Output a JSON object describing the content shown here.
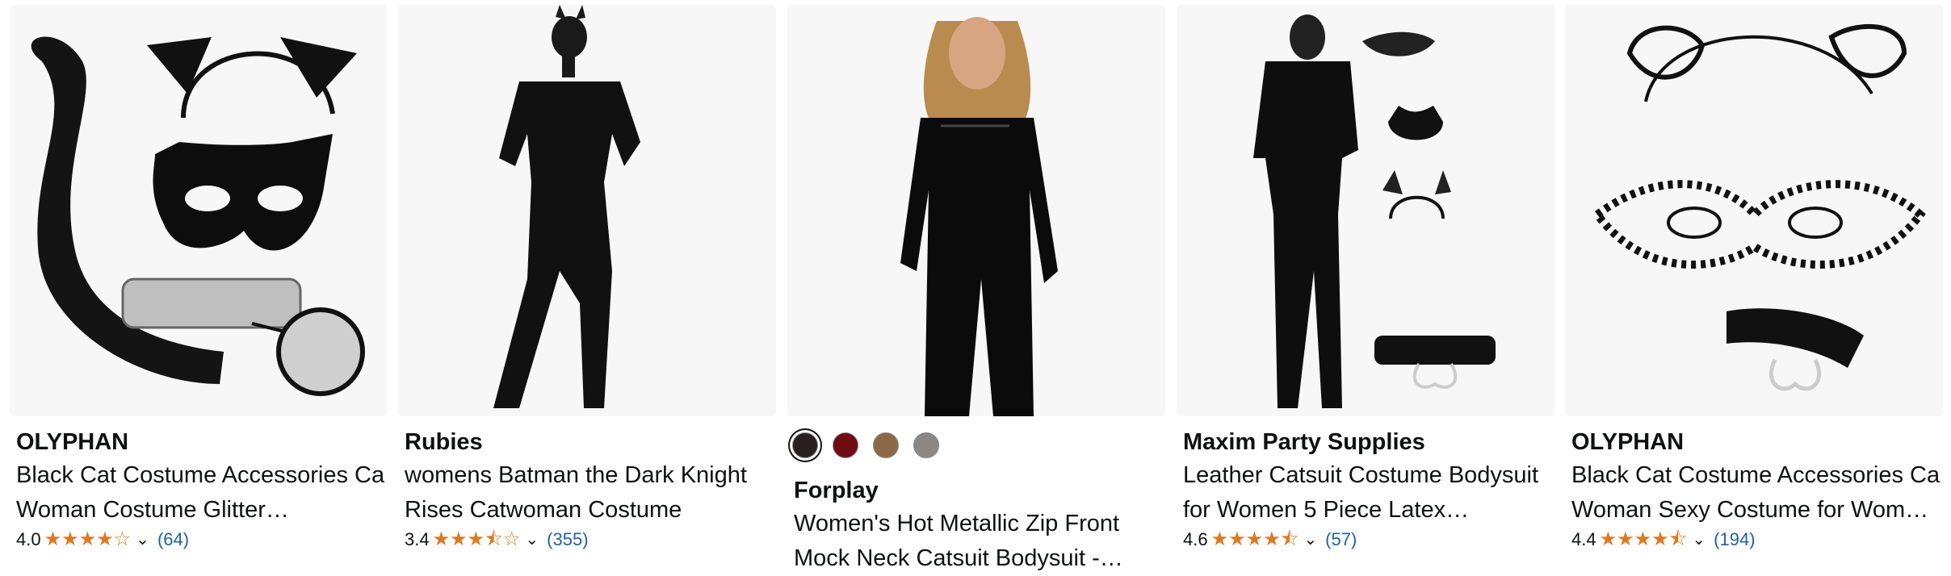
{
  "products": [
    {
      "brand": "OLYPHAN",
      "title_line1": "Black Cat Costume Accessories Cat",
      "title_line2": "Woman Costume Glitter…",
      "rating": "4.0",
      "stars": "★★★★☆",
      "reviews": "(64)",
      "image": "cat-ears-mask-tail-choker-set"
    },
    {
      "brand": "Rubies",
      "title_line1": "womens Batman the Dark Knight",
      "title_line2": "Rises Catwoman Costume",
      "rating": "3.4",
      "stars": "★★★⯪☆",
      "reviews": "(355)",
      "image": "catwoman-suit-model"
    },
    {
      "brand": "Forplay",
      "title_line1": "Women's Hot Metallic Zip Front",
      "title_line2": "Mock Neck Catsuit Bodysuit -…",
      "swatches": [
        "#2a1f1f",
        "#6e0c12",
        "#8b6a45",
        "#8a8784"
      ],
      "image": "metallic-catsuit-model"
    },
    {
      "brand": "Maxim Party Supplies",
      "title_line1": "Leather Catsuit Costume Bodysuit",
      "title_line2": "for Women 5 Piece Latex…",
      "rating": "4.6",
      "stars": "★★★★⯪",
      "reviews": "(57)",
      "image": "latex-catsuit-with-accessories"
    },
    {
      "brand": "OLYPHAN",
      "title_line1": "Black Cat Costume Accessories Cat",
      "title_line2": "Woman Sexy Costume for Wom…",
      "rating": "4.4",
      "stars": "★★★★⯪",
      "reviews": "(194)",
      "image": "lace-mask-ears-choker-set"
    }
  ]
}
